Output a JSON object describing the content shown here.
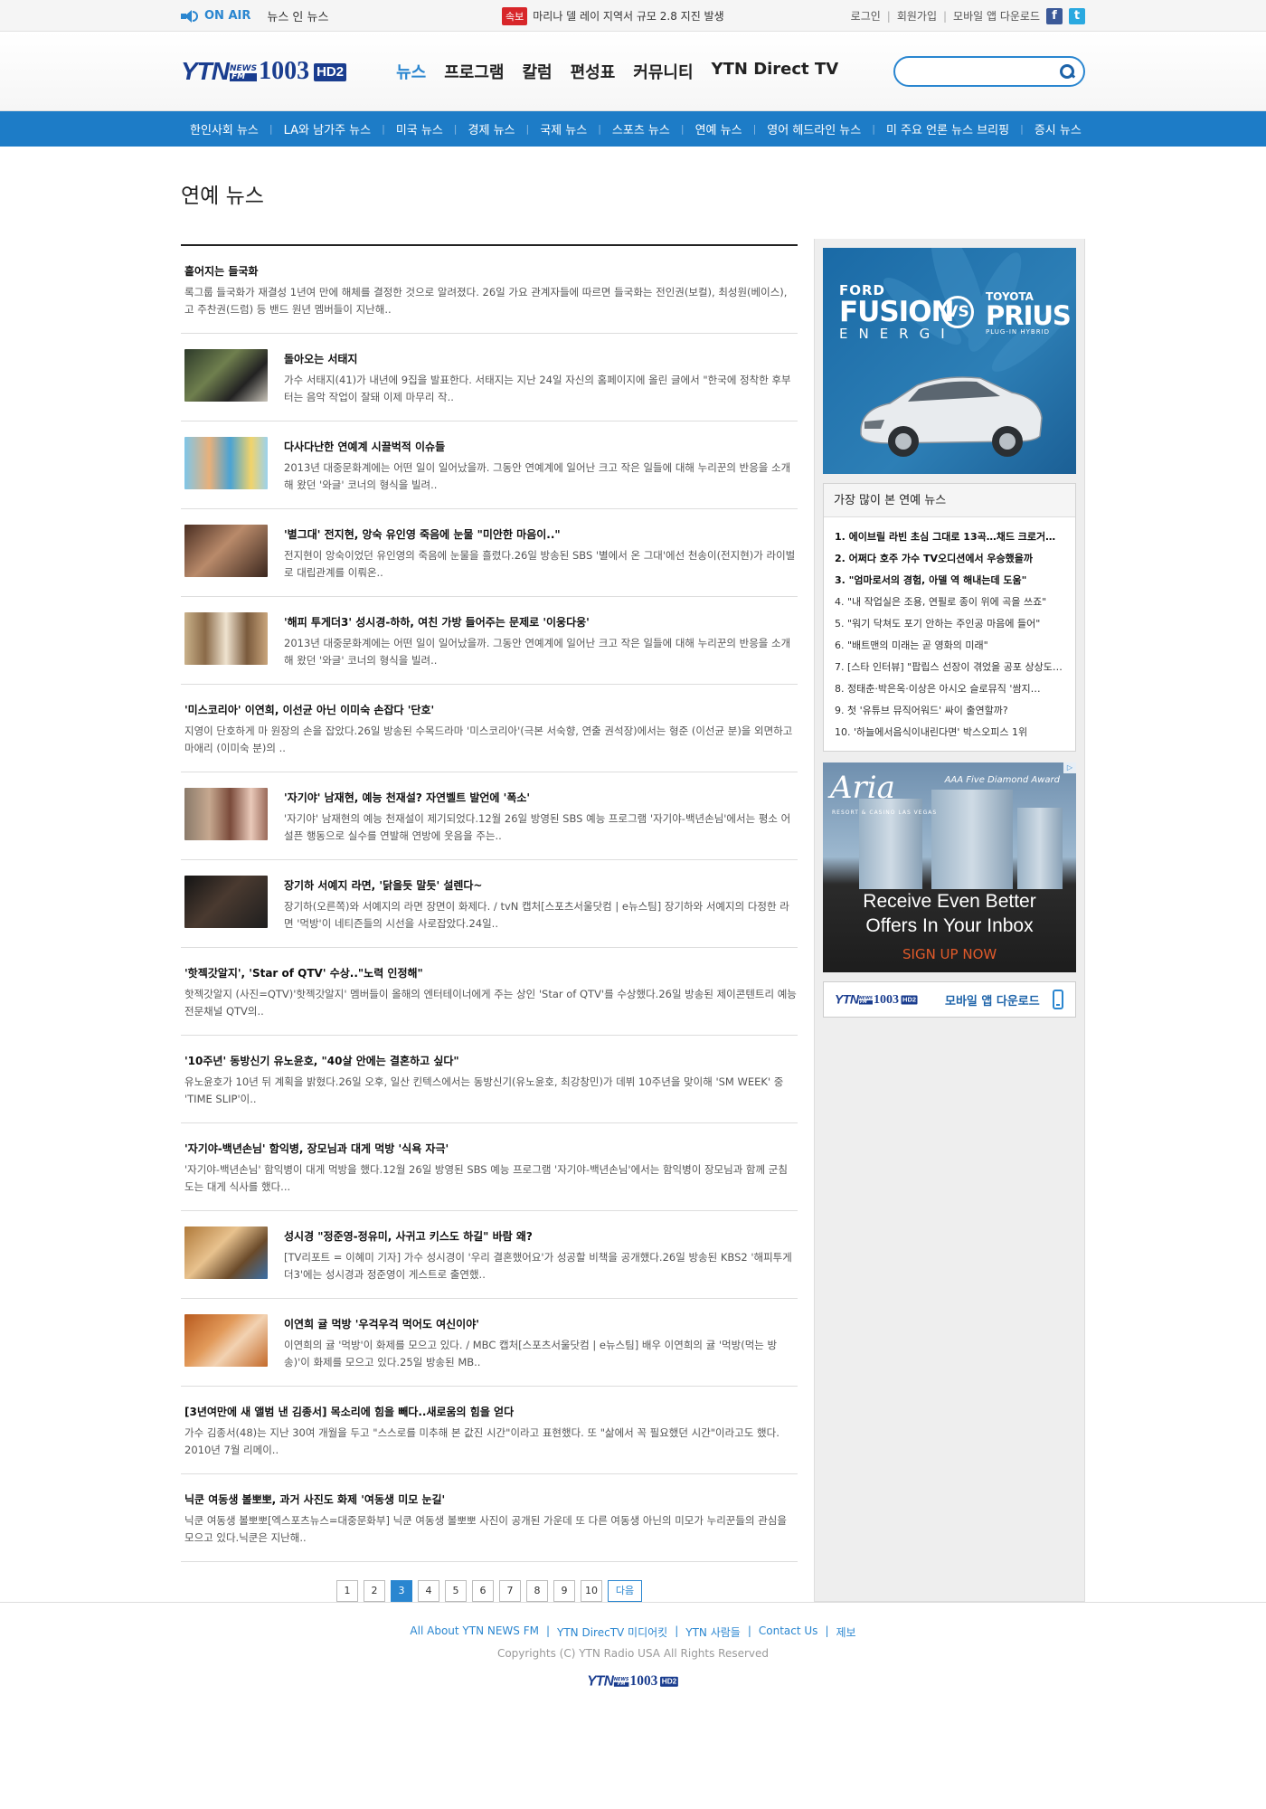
{
  "topbar": {
    "onair": "ON AIR",
    "newsin": "뉴스 인 뉴스",
    "breaking_tag": "속보",
    "breaking_text": "마리나 델 레이 지역서 규모 2.8 지진 발생",
    "links": [
      "로그인",
      "회원가입",
      "모바일 앱 다운로드"
    ],
    "social": [
      {
        "name": "facebook-icon",
        "glyph": "f"
      },
      {
        "name": "twitter-icon",
        "glyph": "t"
      }
    ]
  },
  "logo": {
    "ytn": "YTN",
    "news": "NEWS",
    "fm": "FM",
    "freq": "1003",
    "hd": "HD2"
  },
  "nav": [
    "뉴스",
    "프로그램",
    "칼럼",
    "편성표",
    "커뮤니티",
    "YTN Direct TV"
  ],
  "search": {
    "placeholder": ""
  },
  "subnav": [
    "한인사회 뉴스",
    "LA와 남가주 뉴스",
    "미국 뉴스",
    "경제 뉴스",
    "국제 뉴스",
    "스포츠 뉴스",
    "연예 뉴스",
    "영어 헤드라인 뉴스",
    "미 주요 언론 뉴스 브리핑",
    "증시 뉴스"
  ],
  "page_title": "연예 뉴스",
  "articles": [
    {
      "title": "흩어지는 들국화",
      "summary": "록그룹 들국화가 재결성 1년여 만에 해체를 결정한 것으로 알려졌다. 26일 가요 관계자들에 따르면 들국화는 전인권(보컬), 최성원(베이스), 고 주찬권(드럼) 등 밴드 원년 멤버들이 지난해..",
      "thumb": null
    },
    {
      "title": "돌아오는 서태지",
      "summary": "가수 서태지(41)가 내년에 9집을 발표한다. 서태지는 지난 24일 자신의 홈페이지에 올린 글에서 \"한국에 정착한 후부터는 음악 작업이 잘돼 이제 마무리 작..",
      "thumb": "a"
    },
    {
      "title": "다사다난한 연예계 시끌벅적 이슈들",
      "summary": "2013년 대중문화계에는 어떤 일이 일어났을까. 그동안 연예계에 일어난 크고 작은 일들에 대해 누리꾼의 반응을 소개해 왔던 '와글' 코너의 형식을 빌려..",
      "thumb": "b"
    },
    {
      "title": "'별그대' 전지현, 앙숙 유인영 죽음에 눈물 \"미안한 마음이..\"",
      "summary": "전지현이 앙숙이었던 유인영의 죽음에 눈물을 흘렸다.26일 방송된 SBS '별에서 온 그대'에선 천송이(전지현)가 라이벌로 대립관계를 이뤄온..",
      "thumb": "c"
    },
    {
      "title": "'해피 투게더3' 성시경-하하, 여친 가방 들어주는 문제로 '이웅다웅'",
      "summary": "2013년 대중문화계에는 어떤 일이 일어났을까. 그동안 연예계에 일어난 크고 작은 일들에 대해 누리꾼의 반응을 소개해 왔던 '와글' 코너의 형식을 빌려..",
      "thumb": "d"
    },
    {
      "title": "'미스코리아' 이연희, 이선균 아닌 이미숙 손잡다 '단호'",
      "summary": "지영이 단호하게 마 원장의 손을 잡았다.26일 방송된 수목드라마 '미스코리아'(극본 서숙향, 연출 권석장)에서는 형준 (이선균 분)을 외면하고 마애리 (이미숙 분)의 ..",
      "thumb": null
    },
    {
      "title": "'자기야' 남재현, 예능 천재설? 자연벨트 발언에 '폭소'",
      "summary": "'자기야' 남재현의 예능 천재설이 제기되었다.12월 26일 방영된 SBS 예능 프로그램 '자기야-백년손님'에서는 평소 어설픈 행동으로 실수를 연발해 연방에 웃음을 주는..",
      "thumb": "e"
    },
    {
      "title": "장기하 서예지 라면, '닭을듯 말듯' 설렌다~",
      "summary": "장기하(오른쪽)와 서예지의 라면 장면이 화제다. / tvN 캡처[스포츠서울닷컴 | e뉴스팀] 장기하와 서예지의 다정한 라면 '먹방'이 네티즌들의 시선을 사로잡았다.24일..",
      "thumb": "f"
    },
    {
      "title": "'핫젝갓알지', 'Star of QTV' 수상..\"노력 인정해\"",
      "summary": "핫젝갓알지 (사진=QTV)'핫젝갓알지' 멤버들이 올해의 엔터테이너에게 주는 상인 'Star of QTV'를 수상했다.26일 방송된 제이콘텐트리 예능전문채널 QTV의..",
      "thumb": null
    },
    {
      "title": "'10주년' 동방신기 유노윤호, \"40살 안에는 결혼하고 싶다\"",
      "summary": "유노윤호가 10년 뒤 계획을 밝혔다.26일 오후, 일산 킨텍스에서는 동방신기(유노윤호, 최강창민)가 데뷔 10주년을 맞이해 'SM WEEK' 중 'TIME SLIP'이..",
      "thumb": null
    },
    {
      "title": "'자기야-백년손님' 함익병, 장모님과 대게 먹방 '식욕 자극'",
      "summary": "'자기야-백년손님' 함익병이 대게 먹방을 했다.12월 26일 방영된 SBS 예능 프로그램 '자기야-백년손님'에서는 함익병이 장모님과 함께 군침 도는 대게 식사를 했다...",
      "thumb": null
    },
    {
      "title": "성시경 \"정준영-정유미, 사귀고 키스도 하길\" 바람 왜?",
      "summary": "[TV리포트 = 이혜미 기자] 가수 성시경이 '우리 결혼했어요'가 성공할 비책을 공개했다.26일 방송된 KBS2 '해피투게더3'에는 성시경과 정준영이 게스트로 출연했..",
      "thumb": "g"
    },
    {
      "title": "이연희 귤 먹방 '우걱우걱 먹어도 여신이야'",
      "summary": "이연희의 귤 '먹방'이 화제를 모으고 있다. / MBC 캡처[스포츠서울닷컴 | e뉴스팀] 배우 이연희의 귤 '먹방(먹는 방송)'이 화제를 모으고 있다.25일 방송된 MB..",
      "thumb": "h"
    },
    {
      "title": "[3년여만에 새 앨범 낸 김종서] 목소리에 힘을 빼다..새로움의 힘을 얻다",
      "summary": "가수 김종서(48)는 지난 30여 개월을 두고 \"스스로를 미추해 본 값진 시간\"이라고 표현했다. 또 \"삶에서 꼭 필요했던 시간\"이라고도 했다. 2010년 7월 리메이..",
      "thumb": null
    },
    {
      "title": "닉쿤 여동생 볼뽀뽀, 과거 사진도 화제 '여동생 미모 눈길'",
      "summary": "닉쿤 여동생 볼뽀뽀[엑스포츠뉴스=대중문화부] 닉쿤 여동생 볼뽀뽀 사진이 공개된 가운데 또 다른 여동생 아닌의 미모가 누리꾼들의 관심을 모으고 있다.닉쿤은 지난해..",
      "thumb": null
    }
  ],
  "pagination": {
    "pages": [
      "1",
      "2",
      "3",
      "4",
      "5",
      "6",
      "7",
      "8",
      "9",
      "10"
    ],
    "current": "3",
    "next": "다음"
  },
  "sidebar": {
    "ford_ad": {
      "ford": "FORD",
      "fusion": "FUSION",
      "energi": "ENERGI",
      "vs": "VS",
      "toyota": "TOYOTA",
      "prius": "PRIUS",
      "plugin": "PLUG-IN HYBRID"
    },
    "popular_title": "가장 많이 본 연예 뉴스",
    "popular": [
      {
        "text": "1. 에이브릴 라빈 초심 그대로 13곡…채드 크로거…",
        "bold": true
      },
      {
        "text": "2. 어쩌다 호주 가수 TV오디션에서 우승했을까",
        "bold": true
      },
      {
        "text": "3. \"엄마로서의 경험, 아델 역 해내는데 도움\"",
        "bold": true
      },
      {
        "text": "4. \"내 작업실은 조용, 연필로 종이 위에 곡을 쓰죠\"",
        "bold": false
      },
      {
        "text": "5. \"워기 닥쳐도 포기 안하는 주인공 마음에 들어\"",
        "bold": false
      },
      {
        "text": "6. \"배트맨의 미래는 곧 영화의 미래\"",
        "bold": false
      },
      {
        "text": "7. [스타 인터뷰] \"팝립스 선장이 겪었을 공포 상상도…\"",
        "bold": false
      },
      {
        "text": "8. 정태춘·박은옥·이상은 아시오 슬로뮤직 '쌈지…",
        "bold": false
      },
      {
        "text": "9. 첫 '유튜브 뮤직어워드' 싸이 출연할까?",
        "bold": false
      },
      {
        "text": "10. '하늘에서음식이내린다면' 박스오피스 1위",
        "bold": false
      }
    ],
    "aria_ad": {
      "logo": "Aria",
      "sub": "RESORT & CASINO LAS VEGAS",
      "aaa": "AAA Five Diamond Award",
      "line1": "Receive Even Better",
      "line2": "Offers In Your Inbox",
      "cta": "SIGN UP NOW",
      "adchoice": "▷"
    },
    "app_label": "모바일 앱 다운로드"
  },
  "footer": {
    "links": [
      "All About YTN NEWS FM",
      "YTN DirecTV 미디어킷",
      "YTN 사람들",
      "Contact Us",
      "제보"
    ],
    "copyright": "Copyrights (C) YTN Radio USA All Rights Reserved"
  }
}
